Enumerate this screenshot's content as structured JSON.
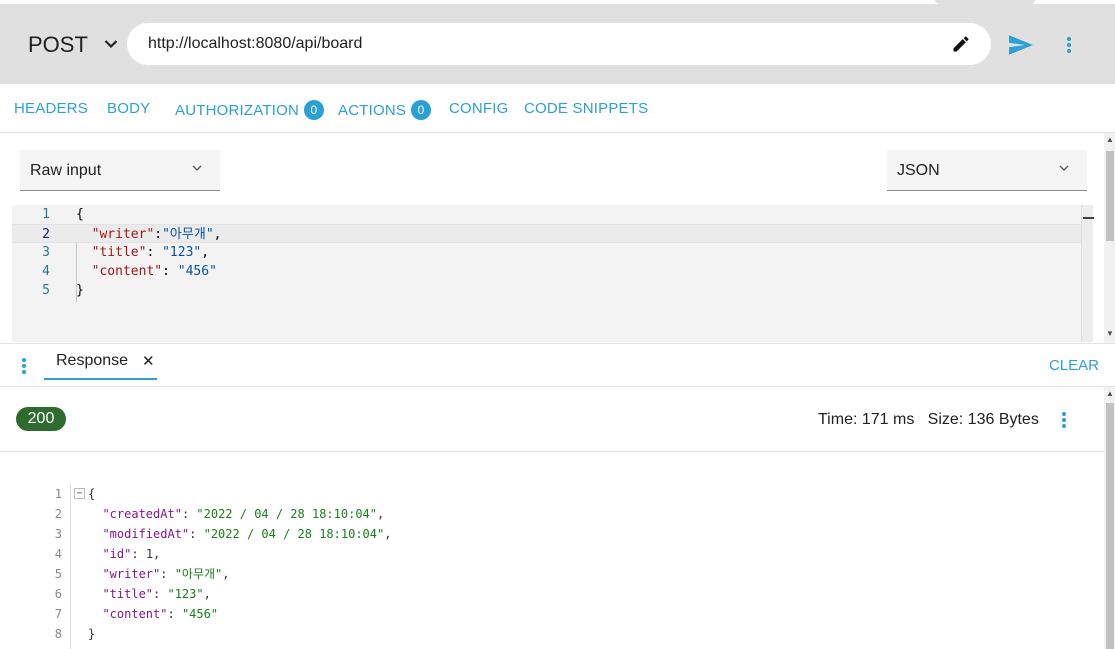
{
  "request": {
    "method": "POST",
    "url": "http://localhost:8080/api/board"
  },
  "tabs": [
    {
      "label": "HEADERS"
    },
    {
      "label": "BODY"
    },
    {
      "label": "AUTHORIZATION",
      "badge": "0"
    },
    {
      "label": "ACTIONS",
      "badge": "0"
    },
    {
      "label": "CONFIG"
    },
    {
      "label": "CODE SNIPPETS"
    }
  ],
  "body_editor": {
    "input_type": "Raw input",
    "content_type": "JSON",
    "lines": [
      {
        "num": "1",
        "text": "{"
      },
      {
        "num": "2",
        "key": "\"writer\"",
        "sep": ":",
        "value": "\"아무개\"",
        "tail": ","
      },
      {
        "num": "3",
        "key": "\"title\"",
        "sep": ": ",
        "value": "\"123\"",
        "tail": ","
      },
      {
        "num": "4",
        "key": "\"content\"",
        "sep": ": ",
        "value": "\"456\"",
        "tail": ""
      },
      {
        "num": "5",
        "text": "}"
      }
    ]
  },
  "response": {
    "tab_label": "Response",
    "clear_label": "CLEAR",
    "status_code": "200",
    "meta": "Time: 171 ms   Size: 136 Bytes",
    "lines": [
      {
        "num": "1",
        "text": "{"
      },
      {
        "num": "2",
        "key": "\"createdAt\"",
        "value": "\"2022 / 04 / 28 18:10:04\"",
        "tail": ","
      },
      {
        "num": "3",
        "key": "\"modifiedAt\"",
        "value": "\"2022 / 04 / 28 18:10:04\"",
        "tail": ","
      },
      {
        "num": "4",
        "key": "\"id\"",
        "value": "1",
        "tail": ","
      },
      {
        "num": "5",
        "key": "\"writer\"",
        "value": "\"아무개\"",
        "tail": ","
      },
      {
        "num": "6",
        "key": "\"title\"",
        "value": "\"123\"",
        "tail": ","
      },
      {
        "num": "7",
        "key": "\"content\"",
        "value": "\"456\"",
        "tail": ""
      },
      {
        "num": "8",
        "text": "}"
      }
    ]
  },
  "colors": {
    "accent": "#2aa0d4",
    "status_ok": "#2e6b2f"
  }
}
